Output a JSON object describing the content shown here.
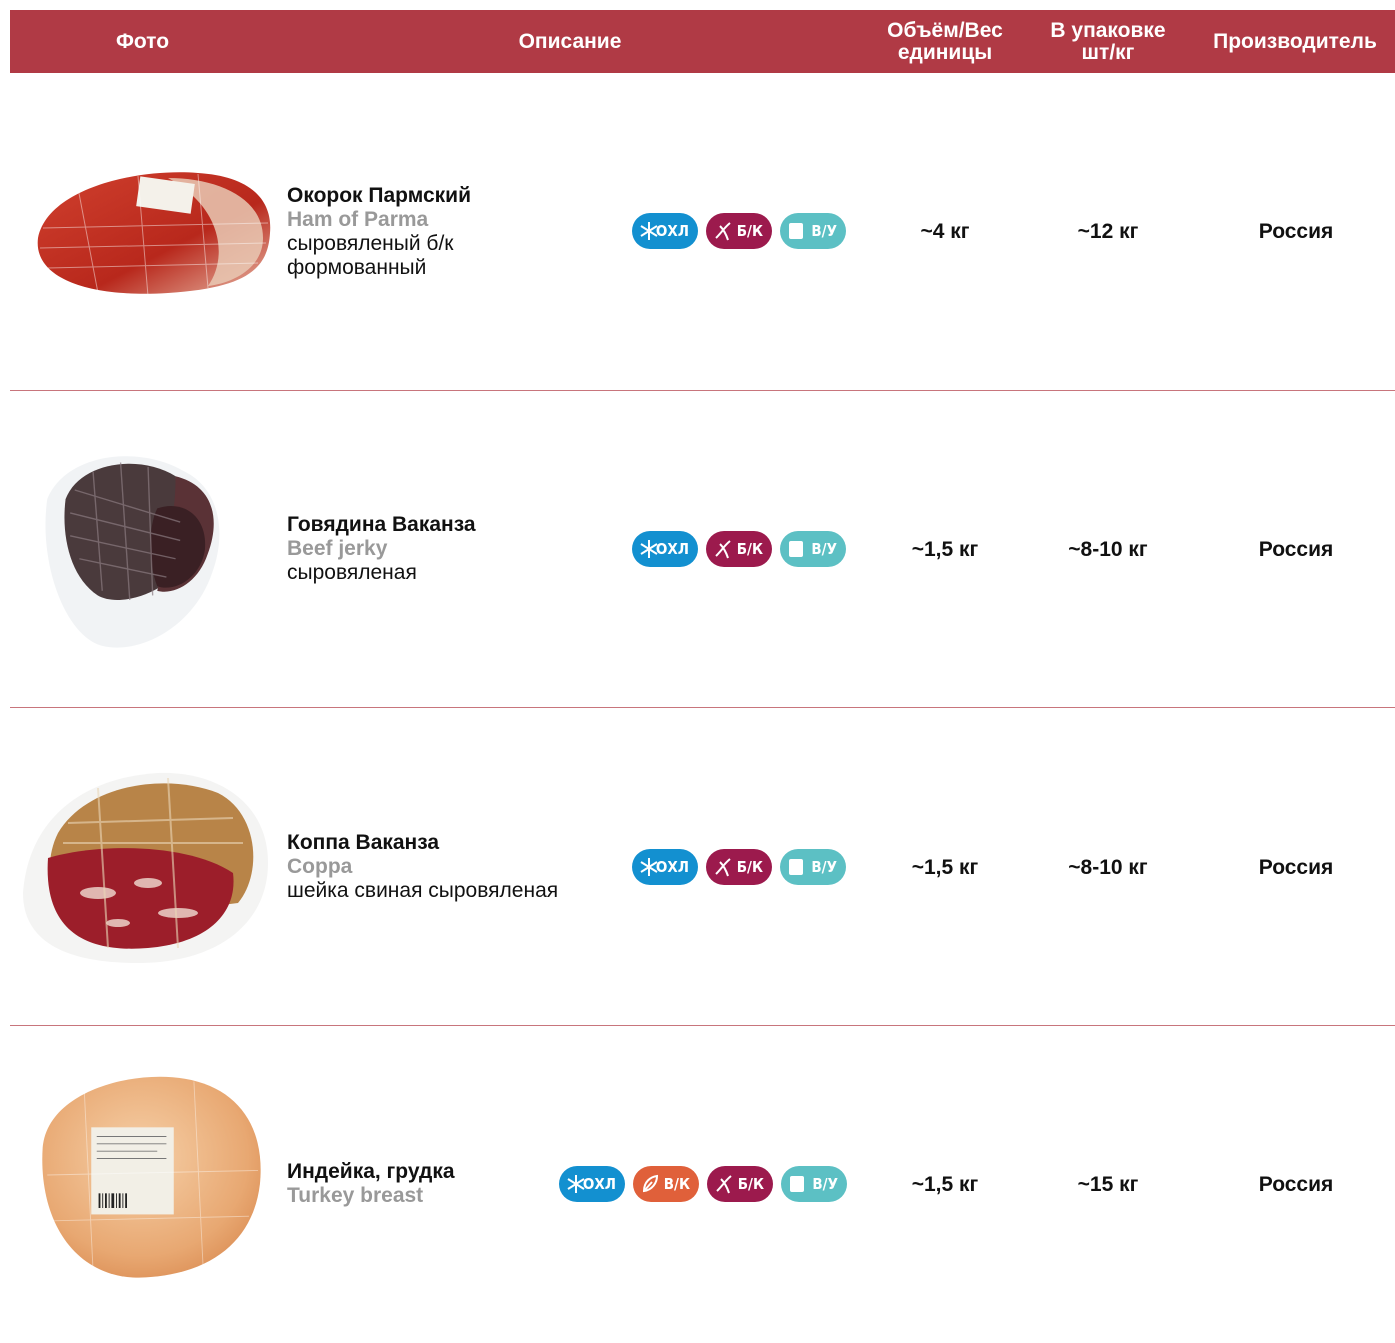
{
  "header": {
    "photo": "Фото",
    "description": "Описание",
    "weight_l1": "Объём/Вес",
    "weight_l2": "единицы",
    "pack_l1": "В упаковке",
    "pack_l2": "шт/кг",
    "producer": "Производитель"
  },
  "colors": {
    "header_bg": "#b03a45",
    "ohl": "#1390d0",
    "bk": "#9c1a4d",
    "vu": "#5cc0c4",
    "vk": "#e0603a"
  },
  "badge_labels": {
    "ohl": "ОХЛ",
    "bk": "Б/К",
    "vu": "В/У",
    "vk": "В/К"
  },
  "rows": [
    {
      "name_ru": "Окорок Пармский",
      "name_en": "Ham of Parma",
      "note_1": "сыровяленый б/к",
      "note_2": "формованный",
      "weight": "~4 кг",
      "pack": "~12 кг",
      "producer": "Россия",
      "badges": [
        "ohl-icon",
        "bk-icon",
        "vu-icon"
      ]
    },
    {
      "name_ru": "Говядина Ваканза",
      "name_en": "Beef jerky",
      "note_1": "сыровяленая",
      "weight": "~1,5 кг",
      "pack": "~8-10 кг",
      "producer": "Россия",
      "badges": [
        "ohl-icon",
        "bk-icon",
        "vu-icon"
      ]
    },
    {
      "name_ru": "Коппа Ваканза",
      "name_en": "Coppa",
      "note_1": "шейка свиная сыровяленая",
      "weight": "~1,5 кг",
      "pack": "~8-10 кг",
      "producer": "Россия",
      "badges": [
        "ohl-icon",
        "bk-icon",
        "vu-icon"
      ]
    },
    {
      "name_ru": "Индейка, грудка",
      "name_en": "Turkey breast",
      "weight": "~1,5 кг",
      "pack": "~15 кг",
      "producer": "Россия",
      "badges": [
        "ohl-icon",
        "vk-icon",
        "bk-icon",
        "vu-icon"
      ]
    }
  ]
}
